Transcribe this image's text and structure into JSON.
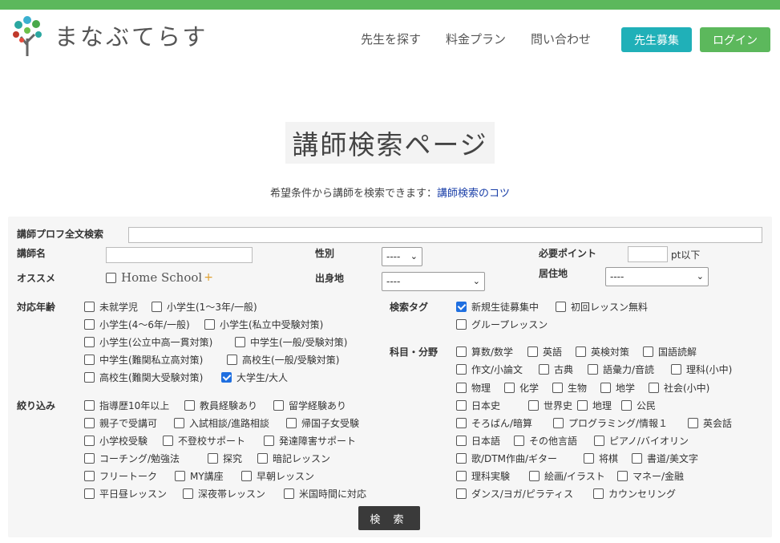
{
  "header": {
    "brand": "まなぶてらす",
    "nav": [
      "先生を探す",
      "料金プラン",
      "問い合わせ"
    ],
    "recruit_label": "先生募集",
    "login_label": "ログイン",
    "colors": {
      "topbar": "#5cb85c",
      "recruit": "#20b0b8",
      "login": "#5cb85c"
    }
  },
  "page": {
    "title": "講師検索ページ",
    "subtitle_text": "希望条件から講師を検索できます：",
    "subtitle_link": "講師検索のコツ"
  },
  "form": {
    "fulltext_label": "講師プロフ全文検索",
    "name_label": "講師名",
    "gender_label": "性別",
    "gender_value": "----",
    "points_label": "必要ポイント",
    "points_suffix": "pt以下",
    "recommend_label": "オススメ",
    "homeschool_text": "Home School",
    "homeschool_mark": "+",
    "birthplace_label": "出身地",
    "birthplace_value": "----",
    "residence_label": "居住地",
    "residence_value": "----",
    "age_label": "対応年齢",
    "ages": [
      {
        "label": "未就学児",
        "checked": false
      },
      {
        "label": "小学生(1〜3年/一般)",
        "checked": false
      },
      {
        "label": "小学生(4〜6年/一般)",
        "checked": false
      },
      {
        "label": "小学生(私立中受験対策)",
        "checked": false
      },
      {
        "label": "小学生(公立中高一貫対策)",
        "checked": false
      },
      {
        "label": "中学生(一般/受験対策)",
        "checked": false
      },
      {
        "label": "中学生(難関私立高対策)",
        "checked": false
      },
      {
        "label": "高校生(一般/受験対策)",
        "checked": false
      },
      {
        "label": "高校生(難関大受験対策)",
        "checked": false
      },
      {
        "label": "大学生/大人",
        "checked": true
      }
    ],
    "filter_label": "絞り込み",
    "filters": [
      {
        "label": "指導歴10年以上",
        "checked": false
      },
      {
        "label": "教員経験あり",
        "checked": false
      },
      {
        "label": "留学経験あり",
        "checked": false
      },
      {
        "label": "親子で受講可",
        "checked": false
      },
      {
        "label": "入試相談/進路相談",
        "checked": false
      },
      {
        "label": "帰国子女受験",
        "checked": false
      },
      {
        "label": "小学校受験",
        "checked": false
      },
      {
        "label": "不登校サポート",
        "checked": false
      },
      {
        "label": "発達障害サポート",
        "checked": false
      },
      {
        "label": "コーチング/勉強法",
        "checked": false
      },
      {
        "label": "探究",
        "checked": false
      },
      {
        "label": "暗記レッスン",
        "checked": false
      },
      {
        "label": "フリートーク",
        "checked": false
      },
      {
        "label": "MY講座",
        "checked": false
      },
      {
        "label": "早朝レッスン",
        "checked": false
      },
      {
        "label": "平日昼レッスン",
        "checked": false
      },
      {
        "label": "深夜帯レッスン",
        "checked": false
      },
      {
        "label": "米国時間に対応",
        "checked": false
      }
    ],
    "tag_label": "検索タグ",
    "tags": [
      {
        "label": "新規生徒募集中",
        "checked": true
      },
      {
        "label": "初回レッスン無料",
        "checked": false
      },
      {
        "label": "グループレッスン",
        "checked": false
      }
    ],
    "subject_label": "科目・分野",
    "subjects": [
      {
        "label": "算数/数学",
        "checked": false
      },
      {
        "label": "英語",
        "checked": false
      },
      {
        "label": "英検対策",
        "checked": false
      },
      {
        "label": "国語読解",
        "checked": false
      },
      {
        "label": "作文/小論文",
        "checked": false
      },
      {
        "label": "古典",
        "checked": false
      },
      {
        "label": "語彙力/音読",
        "checked": false
      },
      {
        "label": "理科(小中)",
        "checked": false
      },
      {
        "label": "物理",
        "checked": false
      },
      {
        "label": "化学",
        "checked": false
      },
      {
        "label": "生物",
        "checked": false
      },
      {
        "label": "地学",
        "checked": false
      },
      {
        "label": "社会(小中)",
        "checked": false
      },
      {
        "label": "日本史",
        "checked": false
      },
      {
        "label": "世界史",
        "checked": false
      },
      {
        "label": "地理",
        "checked": false
      },
      {
        "label": "公民",
        "checked": false
      },
      {
        "label": "そろばん/暗算",
        "checked": false
      },
      {
        "label": "プログラミング/情報１",
        "checked": false
      },
      {
        "label": "英会話",
        "checked": false
      },
      {
        "label": "日本語",
        "checked": false
      },
      {
        "label": "その他言語",
        "checked": false
      },
      {
        "label": "ピアノ/バイオリン",
        "checked": false
      },
      {
        "label": "歌/DTM作曲/ギター",
        "checked": false
      },
      {
        "label": "将棋",
        "checked": false
      },
      {
        "label": "書道/美文字",
        "checked": false
      },
      {
        "label": "理科実験",
        "checked": false
      },
      {
        "label": "絵画/イラスト",
        "checked": false
      },
      {
        "label": "マネー/金融",
        "checked": false
      },
      {
        "label": "ダンス/ヨガ/ピラティス",
        "checked": false
      },
      {
        "label": "カウンセリング",
        "checked": false
      }
    ],
    "search_label": "検 索"
  }
}
